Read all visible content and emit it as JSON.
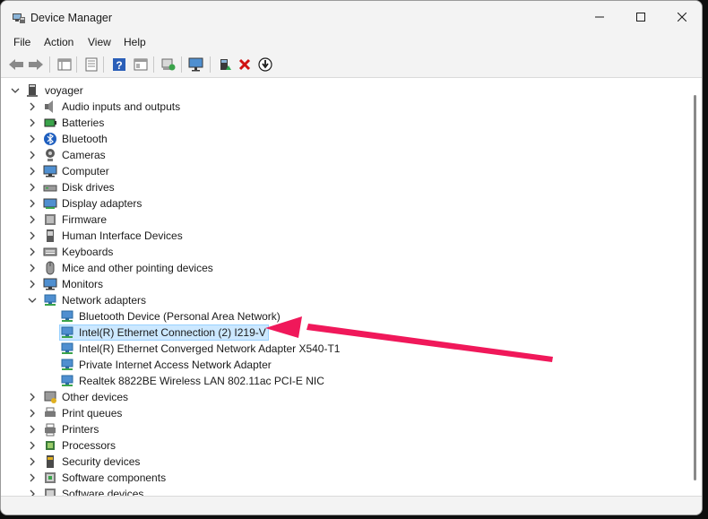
{
  "window": {
    "title": "Device Manager"
  },
  "menu": [
    {
      "label": "File"
    },
    {
      "label": "Action"
    },
    {
      "label": "View"
    },
    {
      "label": "Help"
    }
  ],
  "toolbar": {
    "buttons": [
      {
        "name": "back-icon"
      },
      {
        "name": "forward-icon"
      },
      {
        "name": "properties-icon"
      },
      {
        "name": "update-driver-icon"
      },
      {
        "name": "help-icon"
      },
      {
        "name": "show-hidden-icon"
      },
      {
        "name": "scan-hardware-icon"
      },
      {
        "name": "monitor-icon"
      },
      {
        "name": "add-driver-icon"
      },
      {
        "name": "uninstall-icon"
      },
      {
        "name": "download-icon"
      }
    ]
  },
  "tree": {
    "root": "voyager",
    "categories": [
      {
        "label": "Audio inputs and outputs",
        "icon": "speaker-icon"
      },
      {
        "label": "Batteries",
        "icon": "battery-icon"
      },
      {
        "label": "Bluetooth",
        "icon": "bluetooth-icon"
      },
      {
        "label": "Cameras",
        "icon": "camera-icon"
      },
      {
        "label": "Computer",
        "icon": "computer-icon"
      },
      {
        "label": "Disk drives",
        "icon": "disk-drive-icon"
      },
      {
        "label": "Display adapters",
        "icon": "display-adapter-icon"
      },
      {
        "label": "Firmware",
        "icon": "firmware-icon"
      },
      {
        "label": "Human Interface Devices",
        "icon": "hid-icon"
      },
      {
        "label": "Keyboards",
        "icon": "keyboard-icon"
      },
      {
        "label": "Mice and other pointing devices",
        "icon": "mouse-icon"
      },
      {
        "label": "Monitors",
        "icon": "monitor-icon"
      },
      {
        "label": "Network adapters",
        "icon": "network-adapter-icon",
        "expanded": true
      }
    ],
    "network_children": [
      {
        "label": "Bluetooth Device (Personal Area Network)"
      },
      {
        "label": "Intel(R) Ethernet Connection (2) I219-V",
        "selected": true
      },
      {
        "label": "Intel(R) Ethernet Converged Network Adapter X540-T1"
      },
      {
        "label": "Private Internet Access Network Adapter"
      },
      {
        "label": "Realtek 8822BE Wireless LAN 802.11ac PCI-E NIC"
      }
    ],
    "categories_after": [
      {
        "label": "Other devices",
        "icon": "other-devices-icon"
      },
      {
        "label": "Print queues",
        "icon": "print-queue-icon"
      },
      {
        "label": "Printers",
        "icon": "printer-icon"
      },
      {
        "label": "Processors",
        "icon": "processor-icon"
      },
      {
        "label": "Security devices",
        "icon": "security-device-icon"
      },
      {
        "label": "Software components",
        "icon": "software-component-icon"
      },
      {
        "label": "Software devices",
        "icon": "software-device-icon"
      }
    ]
  },
  "colors": {
    "annotation_arrow": "#f0185a",
    "selection": "#cce8ff"
  }
}
